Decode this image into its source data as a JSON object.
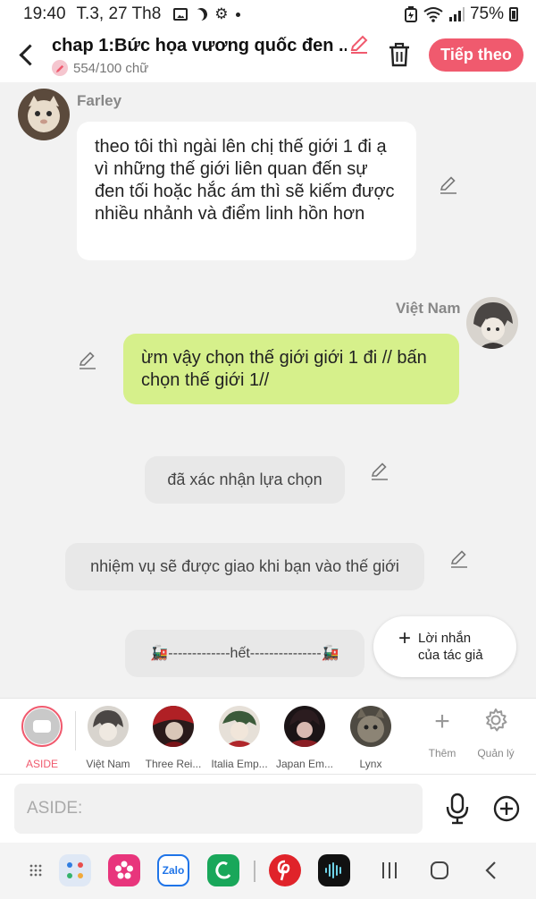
{
  "status_bar": {
    "time": "19:40",
    "date": "T.3, 27 Th8",
    "battery": "75%"
  },
  "header": {
    "title": "chap 1:Bức họa vương quốc đen ...",
    "word_count": "554/100 chữ",
    "next_label": "Tiếp theo"
  },
  "messages": [
    {
      "sender": "Farley",
      "side": "left",
      "text": "theo tôi thì ngài lên chị thế giới 1 đi ạ vì những thế giới liên quan đến sự đen tối hoặc hắc ám thì sẽ kiếm được nhiều nhảnh và điểm linh hồn hơn"
    },
    {
      "sender": "Việt Nam",
      "side": "right",
      "text": "ừm vậy chọn thế giới giới 1 đi // bấn chọn thế giới 1//"
    },
    {
      "side": "narration",
      "text": "đã xác nhận lựa chọn"
    },
    {
      "side": "narration",
      "text": "nhiệm vụ sẽ được giao khi bạn vào thế giới"
    },
    {
      "side": "narration",
      "text": "🚂-------------hết---------------🚂"
    }
  ],
  "float_button": {
    "line1": "Lời nhắn",
    "line2": "của tác giả"
  },
  "characters": [
    {
      "label": "ASIDE"
    },
    {
      "label": "Việt Nam"
    },
    {
      "label": "Three Rei..."
    },
    {
      "label": "Italia Emp..."
    },
    {
      "label": "Japan Em..."
    },
    {
      "label": "Lynx"
    }
  ],
  "tools": {
    "add_label": "Thêm",
    "manage_label": "Quản lý"
  },
  "input": {
    "placeholder": "ASIDE:"
  },
  "apps": {
    "zalo": "Zalo"
  },
  "colors": {
    "accent": "#f05a6e",
    "bubble_right": "#d6f08b",
    "bubble_left": "#ffffff",
    "narration": "#e8e8e8"
  }
}
